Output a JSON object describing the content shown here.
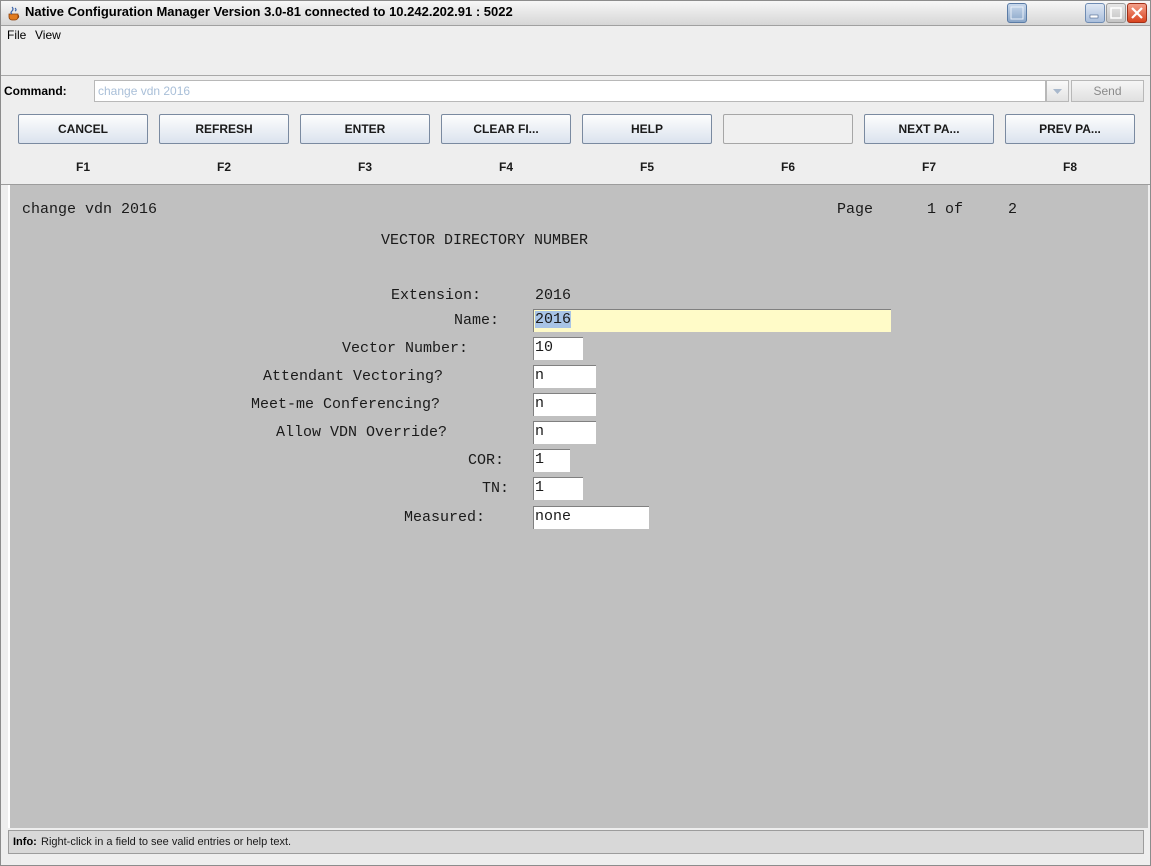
{
  "window": {
    "title": "Native Configuration Manager Version 3.0-81 connected to 10.242.202.91 : 5022"
  },
  "menu": {
    "items": [
      "File",
      "View"
    ]
  },
  "command": {
    "label": "Command:",
    "value": "change vdn 2016",
    "send_label": "Send"
  },
  "function_keys": [
    {
      "label": "CANCEL",
      "key": "F1"
    },
    {
      "label": "REFRESH",
      "key": "F2"
    },
    {
      "label": "ENTER",
      "key": "F3"
    },
    {
      "label": "CLEAR FI...",
      "key": "F4"
    },
    {
      "label": "HELP",
      "key": "F5"
    },
    {
      "label": "",
      "key": "F6"
    },
    {
      "label": "NEXT PA...",
      "key": "F7"
    },
    {
      "label": "PREV PA...",
      "key": "F8"
    }
  ],
  "form": {
    "command_echo": "change vdn 2016",
    "page_label": "Page",
    "page_current": "1",
    "page_of": "of",
    "page_total": "2",
    "heading": "VECTOR DIRECTORY NUMBER",
    "fields": {
      "extension": {
        "label": "Extension:",
        "value": "2016"
      },
      "name": {
        "label": "Name:",
        "value": "2016"
      },
      "vector_number": {
        "label": "Vector Number:",
        "value": "10"
      },
      "attendant_vectoring": {
        "label": "Attendant Vectoring?",
        "value": "n"
      },
      "meet_me": {
        "label": "Meet-me Conferencing?",
        "value": "n"
      },
      "allow_override": {
        "label": "Allow VDN Override?",
        "value": "n"
      },
      "cor": {
        "label": "COR:",
        "value": "1"
      },
      "tn": {
        "label": "TN:",
        "value": "1"
      },
      "measured": {
        "label": "Measured:",
        "value": "none"
      }
    }
  },
  "info": {
    "label": "Info:",
    "text": "Right-click in a field to see valid entries or help text."
  },
  "colors": {
    "form_background": "#c0c0c0",
    "name_field": "#fffbc8",
    "selection": "#a8c4e6",
    "command_text": "#a9bfd8"
  }
}
